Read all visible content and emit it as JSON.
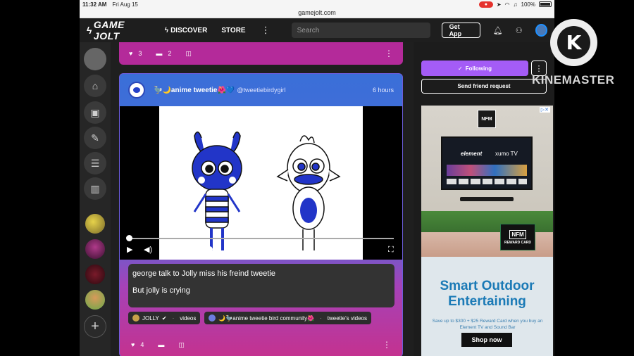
{
  "status_bar": {
    "time": "11:32 AM",
    "date": "Fri Aug 15",
    "battery": "100%"
  },
  "browser": {
    "url": "gamejolt.com"
  },
  "nav": {
    "logo": "GAME JOLT",
    "discover": "DISCOVER",
    "store": "STORE",
    "search_placeholder": "Search",
    "get_app": "Get App"
  },
  "previous_post": {
    "likes": "3",
    "comments": "2"
  },
  "post": {
    "author_name": "🦤🌙anime tweetie🌺💙",
    "author_handle": "@tweetiebirdygirl",
    "time_ago": "6 hours",
    "caption_line1": "george talk to Jolly miss his freind tweetie",
    "caption_line2": "But jolly is crying",
    "tags": [
      {
        "name": "JOLLY",
        "channel": "videos"
      },
      {
        "name": "🌙🦤anime tweetie bird community🌺",
        "channel": "tweetie's videos"
      }
    ],
    "likes": "4",
    "video_progress": 0.02,
    "volume_level": 0.95
  },
  "profile_actions": {
    "following": "Following",
    "friend_request": "Send friend request"
  },
  "ad": {
    "brand": "NFM",
    "tv_brand": "element",
    "tv_platform": "xumo TV",
    "reward_label": "REWARD CARD",
    "headline": "Smart Outdoor Entertaining",
    "subtext": "Save up to $300 + $25 Reward Card when you buy an Element TV and Sound Bar",
    "cta": "Shop now"
  },
  "watermark": {
    "logo_letter": "K",
    "text": "KINEMASTER"
  },
  "colors": {
    "accent_purple": "#a45cf6",
    "card_pink": "#b42a9a",
    "card_blue": "#3a6fd8",
    "ad_blue": "#1b7ab6"
  }
}
